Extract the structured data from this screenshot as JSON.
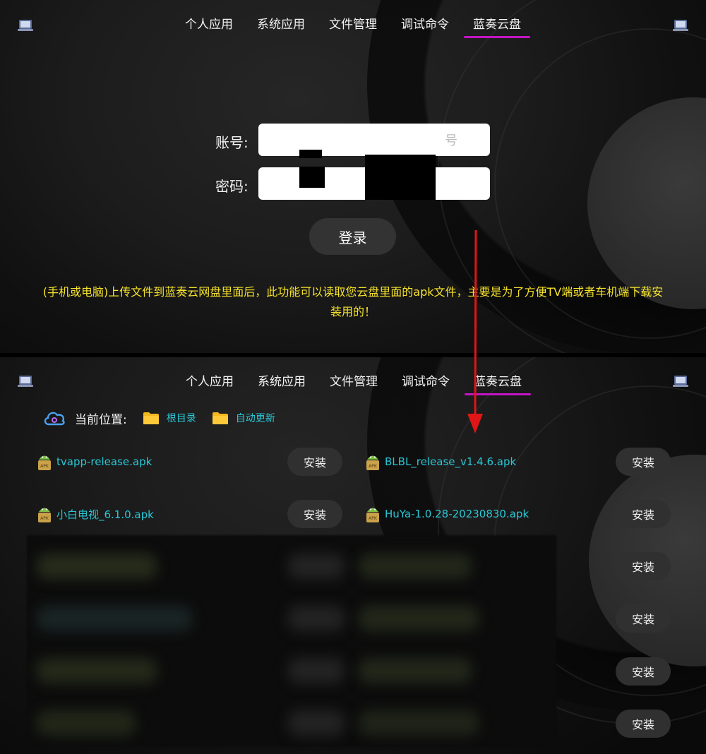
{
  "nav": {
    "tabs": [
      {
        "label": "个人应用"
      },
      {
        "label": "系统应用"
      },
      {
        "label": "文件管理"
      },
      {
        "label": "调试命令"
      },
      {
        "label": "蓝奏云盘",
        "active": true
      }
    ],
    "accent_color": "#c414c4"
  },
  "login": {
    "account_label": "账号:",
    "account_placeholder_visible": "号",
    "password_label": "密码:",
    "password_visible": ".",
    "login_button": "登录",
    "notice": "(手机或电脑)上传文件到蓝奏云网盘里面后，此功能可以读取您云盘里面的apk文件，主要是为了方便TV端或者车机端下载安装用的！",
    "notice_color": "#f6e32a"
  },
  "browser": {
    "location_label": "当前位置:",
    "breadcrumbs": [
      "根目录",
      "自动更新"
    ],
    "link_color": "#29c7d6",
    "files": [
      {
        "name": "tvapp-release.apk"
      },
      {
        "name": "BLBL_release_v1.4.6.apk"
      },
      {
        "name": "小白电视_6.1.0.apk"
      },
      {
        "name": "HuYa-1.0.28-20230830.apk"
      }
    ],
    "install_label": "安装"
  }
}
